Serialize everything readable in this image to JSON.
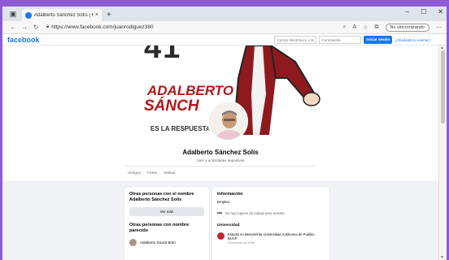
{
  "browser": {
    "tab_title": "Adalberto Sánchez Solís | Faceb…",
    "tab_close": "×",
    "new_tab": "+",
    "url": "https://www.facebook.com/juanrodiguez380",
    "sync_label": "No sincronizando",
    "minimize": "–",
    "restore": "☐",
    "close": "✕"
  },
  "facebook": {
    "logo": "facebook",
    "email_placeholder": "Correo electrónico o tel",
    "password_placeholder": "Contraseña",
    "login_button": "Iniciar sesión",
    "forgot_link": "¿Olvidaste tu cuenta?"
  },
  "cover": {
    "number": "41",
    "name_line1": "ADALBERTO",
    "name_line2": "SÁNCH",
    "slogan": "ES LA RESPUESTA"
  },
  "profile": {
    "name": "Adalberto Sánchez Solís",
    "category": "User y actividades deportivas",
    "tabs": [
      "Amigos",
      "Fotos",
      "Videos"
    ]
  },
  "others_card": {
    "title": "Otras personas con el nombre Adalberto Sánchez Solís",
    "see_more": "Ver más",
    "title2": "Otras personas con nombre parecido",
    "person": "Adalberto Souza Brito"
  },
  "info_card": {
    "title": "Información",
    "employment_label": "Empleo",
    "employment_value": "No hay lugares de trabajo para mostrar",
    "university_label": "Universidad",
    "university_value": "Estudió en Benemérita Universidad Autónoma de Puebla - BUAP",
    "university_date": "Promoción de 1994"
  },
  "colors": {
    "frame": "#8e5bd6",
    "facebook_blue": "#1877f2",
    "cover_red": "#b3171c"
  }
}
